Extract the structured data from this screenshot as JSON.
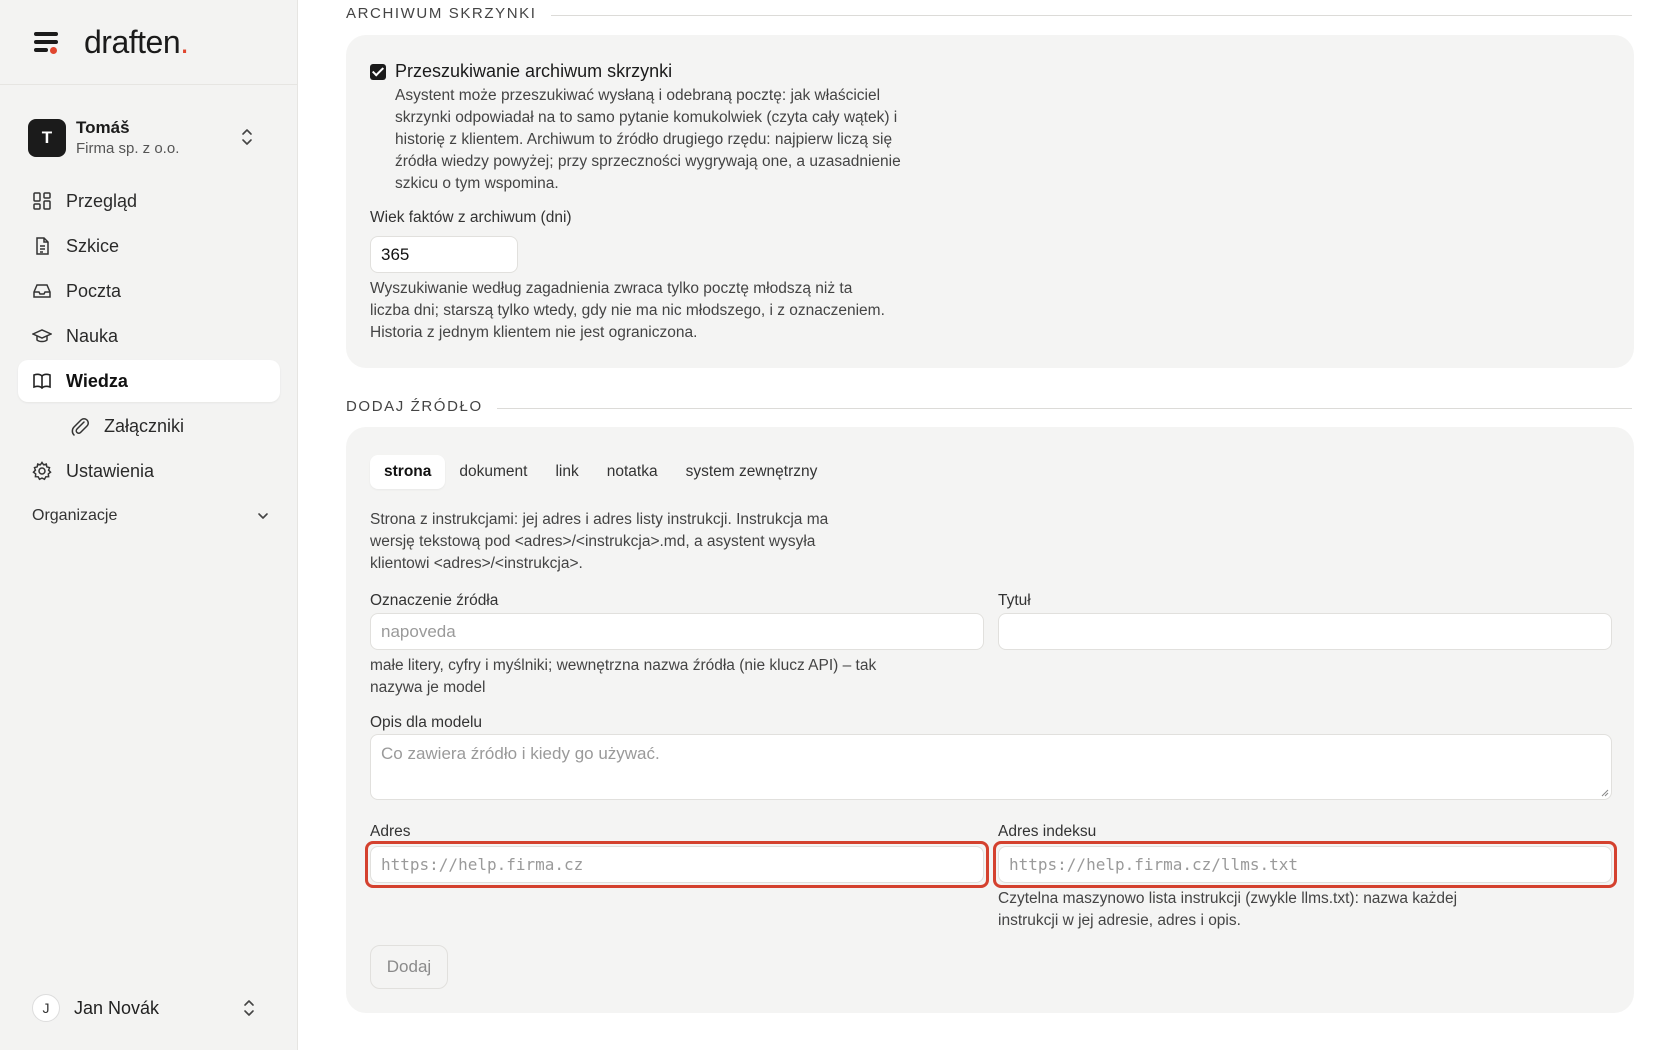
{
  "brand": {
    "name": "draften",
    "dot": "."
  },
  "org": {
    "initial": "T",
    "name": "Tomáš",
    "company": "Firma sp. z o.o."
  },
  "nav": {
    "items": [
      {
        "label": "Przegląd",
        "icon": "dashboard-icon"
      },
      {
        "label": "Szkice",
        "icon": "document-icon"
      },
      {
        "label": "Poczta",
        "icon": "inbox-icon"
      },
      {
        "label": "Nauka",
        "icon": "graduation-cap-icon"
      },
      {
        "label": "Wiedza",
        "icon": "book-icon",
        "active": true
      },
      {
        "label": "Załączniki",
        "icon": "paperclip-icon",
        "sub": true
      },
      {
        "label": "Ustawienia",
        "icon": "gear-icon"
      }
    ],
    "section_label": "Organizacje"
  },
  "user": {
    "initial": "J",
    "name": "Jan Novák"
  },
  "archive": {
    "heading": "ARCHIWUM SKRZYNKI",
    "checkbox_label": "Przeszukiwanie archiwum skrzynki",
    "checked": true,
    "description": "Asystent może przeszukiwać wysłaną i odebraną pocztę: jak właściciel skrzynki odpowiadał na to samo pytanie komukolwiek (czyta cały wątek) i historię z klientem. Archiwum to źródło drugiego rzędu: najpierw liczą się źródła wiedzy powyżej; przy sprzeczności wygrywają one, a uzasadnienie szkicu o tym wspomina.",
    "age_label": "Wiek faktów z archiwum (dni)",
    "age_value": "365",
    "age_help": "Wyszukiwanie według zagadnienia zwraca tylko pocztę młodszą niż ta liczba dni; starszą tylko wtedy, gdy nie ma nic młodszego, i z oznaczeniem. Historia z jednym klientem nie jest ograniczona."
  },
  "add_source": {
    "heading": "DODAJ ŹRÓDŁO",
    "tabs": [
      "strona",
      "dokument",
      "link",
      "notatka",
      "system zewnętrzny"
    ],
    "active_tab": "strona",
    "intro": "Strona z instrukcjami: jej adres i adres listy instrukcji. Instrukcja ma wersję tekstową pod <adres>/<instrukcja>.md, a asystent wysyła klientowi <adres>/<instrukcja>.",
    "slug_label": "Oznaczenie źródła",
    "slug_placeholder": "napoveda",
    "slug_help": "małe litery, cyfry i myślniki; wewnętrzna nazwa źródła (nie klucz API) – tak nazywa je model",
    "title_label": "Tytuł",
    "title_value": "",
    "desc_label": "Opis dla modelu",
    "desc_placeholder": "Co zawiera źródło i kiedy go używać.",
    "url_label": "Adres",
    "url_placeholder": "https://help.firma.cz",
    "index_label": "Adres indeksu",
    "index_placeholder": "https://help.firma.cz/llms.txt",
    "index_help": "Czytelna maszynowo lista instrukcji (zwykle llms.txt): nazwa każdej instrukcji w jej adresie, adres i opis.",
    "submit_label": "Dodaj"
  },
  "colors": {
    "accent": "#e0462f",
    "highlight": "#d4412e",
    "card": "#f4f4f3",
    "sidebar": "#f3f3f2"
  }
}
